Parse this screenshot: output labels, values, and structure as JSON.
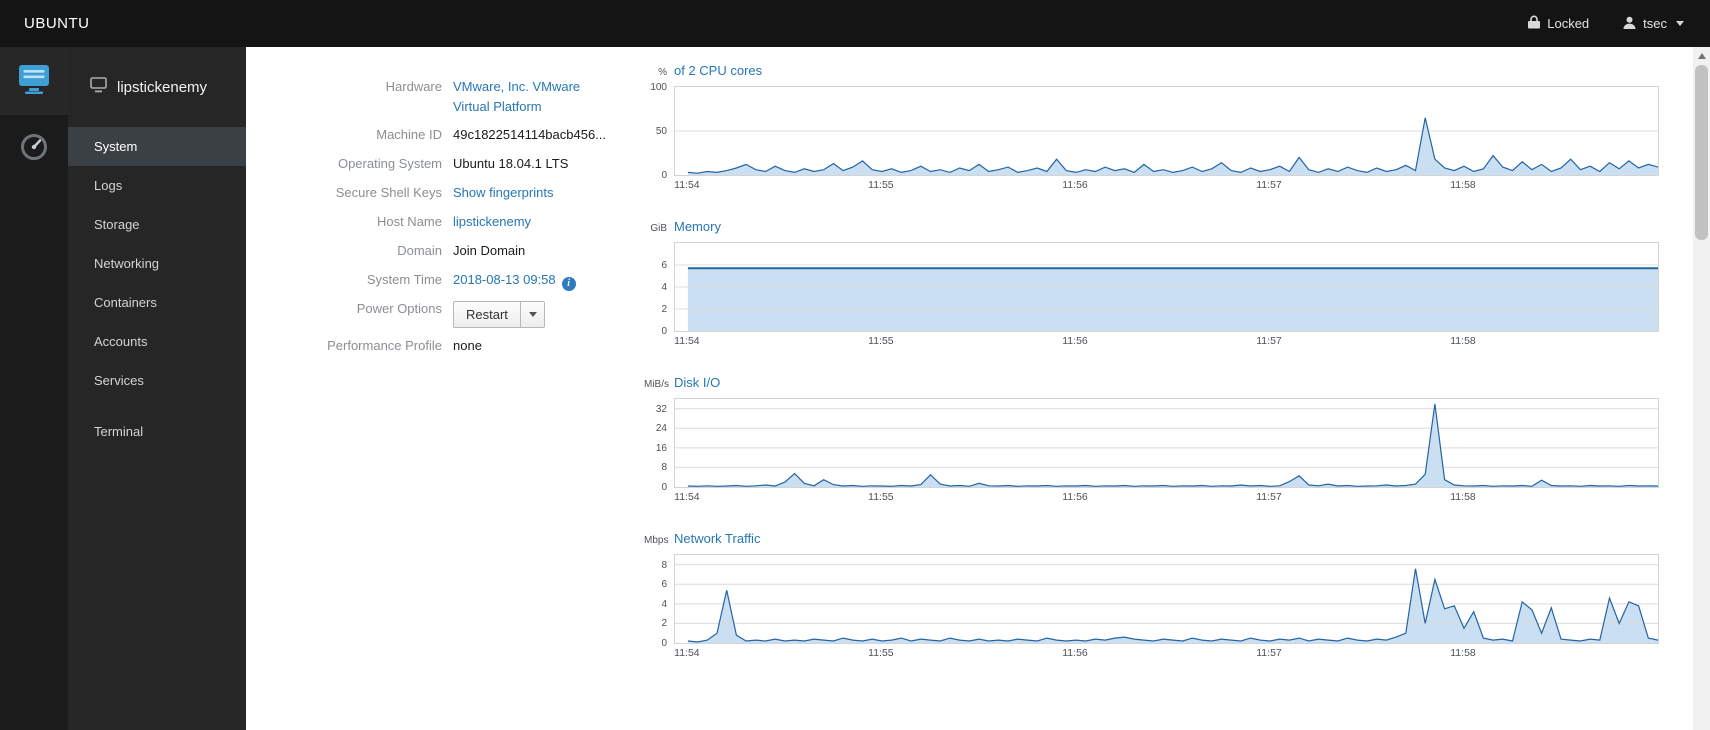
{
  "topbar": {
    "brand": "UBUNTU",
    "locked_label": "Locked",
    "user": "tsec"
  },
  "sidebar": {
    "host": "lipstickenemy",
    "items": [
      {
        "label": "System",
        "selected": true
      },
      {
        "label": "Logs",
        "selected": false
      },
      {
        "label": "Storage",
        "selected": false
      },
      {
        "label": "Networking",
        "selected": false
      },
      {
        "label": "Containers",
        "selected": false
      },
      {
        "label": "Accounts",
        "selected": false
      },
      {
        "label": "Services",
        "selected": false
      }
    ],
    "secondary_items": [
      {
        "label": "Terminal",
        "selected": false
      }
    ]
  },
  "system_info": {
    "info_glyph": "i",
    "rows": [
      {
        "label": "Hardware",
        "value": "VMware, Inc. VMware",
        "value2": "Virtual Platform",
        "kind": "link"
      },
      {
        "label": "Machine ID",
        "value": "49c1822514114bacb456...",
        "kind": "text"
      },
      {
        "label": "Operating System",
        "value": "Ubuntu 18.04.1 LTS",
        "kind": "text"
      },
      {
        "label": "Secure Shell Keys",
        "value": "Show fingerprints",
        "kind": "link"
      },
      {
        "label": "Host Name",
        "value": "lipstickenemy",
        "kind": "link"
      },
      {
        "label": "Domain",
        "value": "Join Domain",
        "kind": "text"
      },
      {
        "label": "System Time",
        "value": "2018-08-13 09:58",
        "kind": "link-info"
      },
      {
        "label": "Power Options",
        "value": "Restart",
        "kind": "split-button"
      },
      {
        "label": "Performance Profile",
        "value": "none",
        "kind": "text"
      }
    ]
  },
  "chart_colors": {
    "line": "#2264a5",
    "fill": "#bdd7ee",
    "grid": "#dcdcdc",
    "link": "#2577b5"
  },
  "chart_data": [
    {
      "type": "area",
      "unit": "%",
      "title": "of 2 CPU cores",
      "ylim": [
        0,
        100
      ],
      "yticks": [
        0,
        50,
        100
      ],
      "xtick_labels": [
        "11:54",
        "11:55",
        "11:56",
        "11:57",
        "11:58"
      ],
      "xtick_seconds": [
        0,
        60,
        120,
        180,
        240
      ],
      "xlim": [
        -4,
        300
      ],
      "stroke_width": 1.2,
      "points": [
        [
          0,
          3
        ],
        [
          3,
          2
        ],
        [
          6,
          4
        ],
        [
          9,
          3
        ],
        [
          12,
          5
        ],
        [
          15,
          8
        ],
        [
          18,
          12
        ],
        [
          21,
          6
        ],
        [
          24,
          4
        ],
        [
          27,
          10
        ],
        [
          30,
          5
        ],
        [
          33,
          3
        ],
        [
          36,
          7
        ],
        [
          39,
          4
        ],
        [
          42,
          6
        ],
        [
          45,
          13
        ],
        [
          48,
          5
        ],
        [
          51,
          9
        ],
        [
          54,
          16
        ],
        [
          57,
          6
        ],
        [
          60,
          4
        ],
        [
          63,
          7
        ],
        [
          66,
          3
        ],
        [
          69,
          5
        ],
        [
          72,
          10
        ],
        [
          75,
          4
        ],
        [
          78,
          6
        ],
        [
          81,
          3
        ],
        [
          84,
          8
        ],
        [
          87,
          5
        ],
        [
          90,
          12
        ],
        [
          93,
          4
        ],
        [
          96,
          6
        ],
        [
          99,
          9
        ],
        [
          102,
          3
        ],
        [
          105,
          5
        ],
        [
          108,
          8
        ],
        [
          111,
          4
        ],
        [
          114,
          18
        ],
        [
          117,
          5
        ],
        [
          120,
          3
        ],
        [
          123,
          6
        ],
        [
          126,
          4
        ],
        [
          129,
          9
        ],
        [
          132,
          5
        ],
        [
          135,
          7
        ],
        [
          138,
          3
        ],
        [
          141,
          12
        ],
        [
          144,
          4
        ],
        [
          147,
          6
        ],
        [
          150,
          3
        ],
        [
          153,
          5
        ],
        [
          156,
          9
        ],
        [
          159,
          4
        ],
        [
          162,
          7
        ],
        [
          165,
          14
        ],
        [
          168,
          5
        ],
        [
          171,
          3
        ],
        [
          174,
          8
        ],
        [
          177,
          4
        ],
        [
          180,
          6
        ],
        [
          183,
          10
        ],
        [
          186,
          4
        ],
        [
          189,
          20
        ],
        [
          192,
          6
        ],
        [
          195,
          3
        ],
        [
          198,
          7
        ],
        [
          201,
          4
        ],
        [
          204,
          9
        ],
        [
          207,
          5
        ],
        [
          210,
          3
        ],
        [
          213,
          8
        ],
        [
          216,
          4
        ],
        [
          219,
          6
        ],
        [
          222,
          11
        ],
        [
          225,
          5
        ],
        [
          228,
          65
        ],
        [
          231,
          18
        ],
        [
          234,
          8
        ],
        [
          237,
          5
        ],
        [
          240,
          10
        ],
        [
          243,
          4
        ],
        [
          246,
          7
        ],
        [
          249,
          22
        ],
        [
          252,
          9
        ],
        [
          255,
          5
        ],
        [
          258,
          15
        ],
        [
          261,
          6
        ],
        [
          264,
          12
        ],
        [
          267,
          4
        ],
        [
          270,
          8
        ],
        [
          273,
          18
        ],
        [
          276,
          6
        ],
        [
          279,
          10
        ],
        [
          282,
          4
        ],
        [
          285,
          14
        ],
        [
          288,
          7
        ],
        [
          291,
          16
        ],
        [
          294,
          8
        ],
        [
          297,
          12
        ],
        [
          300,
          9
        ]
      ]
    },
    {
      "type": "area",
      "unit": "GiB",
      "title": "Memory",
      "ylim": [
        0,
        8
      ],
      "yticks": [
        0,
        2,
        4,
        6
      ],
      "xtick_labels": [
        "11:54",
        "11:55",
        "11:56",
        "11:57",
        "11:58"
      ],
      "xtick_seconds": [
        0,
        60,
        120,
        180,
        240
      ],
      "xlim": [
        -4,
        300
      ],
      "stroke_width": 2,
      "points": [
        [
          0,
          5.7
        ],
        [
          60,
          5.7
        ],
        [
          120,
          5.7
        ],
        [
          180,
          5.7
        ],
        [
          240,
          5.7
        ],
        [
          300,
          5.7
        ]
      ]
    },
    {
      "type": "area",
      "unit": "MiB/s",
      "title": "Disk I/O",
      "ylim": [
        0,
        36
      ],
      "yticks": [
        0,
        8,
        16,
        24,
        32
      ],
      "xtick_labels": [
        "11:54",
        "11:55",
        "11:56",
        "11:57",
        "11:58"
      ],
      "xtick_seconds": [
        0,
        60,
        120,
        180,
        240
      ],
      "xlim": [
        -4,
        300
      ],
      "stroke_width": 1.2,
      "points": [
        [
          0,
          0.4
        ],
        [
          3,
          0.3
        ],
        [
          6,
          0.5
        ],
        [
          9,
          0.3
        ],
        [
          12,
          0.4
        ],
        [
          15,
          0.6
        ],
        [
          18,
          0.3
        ],
        [
          21,
          0.5
        ],
        [
          24,
          0.8
        ],
        [
          27,
          0.4
        ],
        [
          30,
          2
        ],
        [
          33,
          5.5
        ],
        [
          36,
          1.5
        ],
        [
          39,
          0.5
        ],
        [
          42,
          3
        ],
        [
          45,
          1
        ],
        [
          48,
          0.4
        ],
        [
          51,
          0.6
        ],
        [
          54,
          0.3
        ],
        [
          57,
          0.5
        ],
        [
          60,
          0.4
        ],
        [
          63,
          0.3
        ],
        [
          66,
          0.6
        ],
        [
          69,
          0.4
        ],
        [
          72,
          1
        ],
        [
          75,
          5
        ],
        [
          78,
          1.2
        ],
        [
          81,
          0.4
        ],
        [
          84,
          0.6
        ],
        [
          87,
          0.3
        ],
        [
          90,
          1.5
        ],
        [
          93,
          0.5
        ],
        [
          96,
          0.4
        ],
        [
          99,
          0.6
        ],
        [
          102,
          0.3
        ],
        [
          105,
          0.5
        ],
        [
          108,
          0.4
        ],
        [
          111,
          0.6
        ],
        [
          114,
          0.3
        ],
        [
          117,
          0.5
        ],
        [
          120,
          0.4
        ],
        [
          123,
          0.6
        ],
        [
          126,
          0.3
        ],
        [
          129,
          0.5
        ],
        [
          132,
          0.4
        ],
        [
          135,
          0.6
        ],
        [
          138,
          0.3
        ],
        [
          141,
          0.5
        ],
        [
          144,
          0.4
        ],
        [
          147,
          0.6
        ],
        [
          150,
          0.3
        ],
        [
          153,
          0.5
        ],
        [
          156,
          0.4
        ],
        [
          159,
          0.6
        ],
        [
          162,
          0.3
        ],
        [
          165,
          0.5
        ],
        [
          168,
          0.4
        ],
        [
          171,
          0.8
        ],
        [
          174,
          0.4
        ],
        [
          177,
          0.6
        ],
        [
          180,
          0.3
        ],
        [
          183,
          0.5
        ],
        [
          186,
          2.2
        ],
        [
          189,
          4.6
        ],
        [
          192,
          0.8
        ],
        [
          195,
          0.5
        ],
        [
          198,
          1.2
        ],
        [
          201,
          0.4
        ],
        [
          204,
          0.6
        ],
        [
          207,
          0.3
        ],
        [
          210,
          0.4
        ],
        [
          213,
          0.5
        ],
        [
          216,
          0.8
        ],
        [
          219,
          0.4
        ],
        [
          222,
          0.6
        ],
        [
          225,
          1.2
        ],
        [
          228,
          5.2
        ],
        [
          231,
          34
        ],
        [
          234,
          3
        ],
        [
          237,
          0.8
        ],
        [
          240,
          0.5
        ],
        [
          243,
          0.4
        ],
        [
          246,
          0.6
        ],
        [
          249,
          0.3
        ],
        [
          252,
          0.5
        ],
        [
          255,
          0.4
        ],
        [
          258,
          0.6
        ],
        [
          261,
          0.3
        ],
        [
          264,
          2.8
        ],
        [
          267,
          0.6
        ],
        [
          270,
          0.4
        ],
        [
          273,
          0.5
        ],
        [
          276,
          0.3
        ],
        [
          279,
          0.6
        ],
        [
          282,
          0.4
        ],
        [
          285,
          0.5
        ],
        [
          288,
          0.3
        ],
        [
          291,
          0.6
        ],
        [
          294,
          0.4
        ],
        [
          297,
          0.5
        ],
        [
          300,
          0.4
        ]
      ]
    },
    {
      "type": "area",
      "unit": "Mbps",
      "title": "Network Traffic",
      "ylim": [
        0,
        9
      ],
      "yticks": [
        0,
        2,
        4,
        6,
        8
      ],
      "xtick_labels": [
        "11:54",
        "11:55",
        "11:56",
        "11:57",
        "11:58"
      ],
      "xtick_seconds": [
        0,
        60,
        120,
        180,
        240
      ],
      "xlim": [
        -4,
        300
      ],
      "stroke_width": 1.2,
      "points": [
        [
          0,
          0.2
        ],
        [
          3,
          0.1
        ],
        [
          6,
          0.3
        ],
        [
          9,
          1
        ],
        [
          12,
          5.4
        ],
        [
          15,
          0.8
        ],
        [
          18,
          0.2
        ],
        [
          21,
          0.3
        ],
        [
          24,
          0.2
        ],
        [
          27,
          0.4
        ],
        [
          30,
          0.2
        ],
        [
          33,
          0.3
        ],
        [
          36,
          0.2
        ],
        [
          39,
          0.4
        ],
        [
          42,
          0.3
        ],
        [
          45,
          0.2
        ],
        [
          48,
          0.5
        ],
        [
          51,
          0.3
        ],
        [
          54,
          0.2
        ],
        [
          57,
          0.4
        ],
        [
          60,
          0.2
        ],
        [
          63,
          0.3
        ],
        [
          66,
          0.5
        ],
        [
          69,
          0.2
        ],
        [
          72,
          0.4
        ],
        [
          75,
          0.3
        ],
        [
          78,
          0.2
        ],
        [
          81,
          0.5
        ],
        [
          84,
          0.3
        ],
        [
          87,
          0.2
        ],
        [
          90,
          0.4
        ],
        [
          93,
          0.2
        ],
        [
          96,
          0.3
        ],
        [
          99,
          0.2
        ],
        [
          102,
          0.4
        ],
        [
          105,
          0.3
        ],
        [
          108,
          0.2
        ],
        [
          111,
          0.5
        ],
        [
          114,
          0.3
        ],
        [
          117,
          0.2
        ],
        [
          120,
          0.3
        ],
        [
          123,
          0.2
        ],
        [
          126,
          0.4
        ],
        [
          129,
          0.3
        ],
        [
          132,
          0.5
        ],
        [
          135,
          0.6
        ],
        [
          138,
          0.4
        ],
        [
          141,
          0.3
        ],
        [
          144,
          0.2
        ],
        [
          147,
          0.4
        ],
        [
          150,
          0.3
        ],
        [
          153,
          0.2
        ],
        [
          156,
          0.5
        ],
        [
          159,
          0.3
        ],
        [
          162,
          0.2
        ],
        [
          165,
          0.4
        ],
        [
          168,
          0.3
        ],
        [
          171,
          0.2
        ],
        [
          174,
          0.5
        ],
        [
          177,
          0.3
        ],
        [
          180,
          0.2
        ],
        [
          183,
          0.4
        ],
        [
          186,
          0.3
        ],
        [
          189,
          0.5
        ],
        [
          192,
          0.2
        ],
        [
          195,
          0.4
        ],
        [
          198,
          0.3
        ],
        [
          201,
          0.2
        ],
        [
          204,
          0.5
        ],
        [
          207,
          0.3
        ],
        [
          210,
          0.2
        ],
        [
          213,
          0.4
        ],
        [
          216,
          0.3
        ],
        [
          219,
          0.6
        ],
        [
          222,
          1
        ],
        [
          225,
          7.6
        ],
        [
          228,
          2
        ],
        [
          231,
          6.5
        ],
        [
          234,
          3.5
        ],
        [
          237,
          3.8
        ],
        [
          240,
          1.5
        ],
        [
          243,
          3.2
        ],
        [
          246,
          0.5
        ],
        [
          249,
          0.3
        ],
        [
          252,
          0.4
        ],
        [
          255,
          0.2
        ],
        [
          258,
          4.2
        ],
        [
          261,
          3.4
        ],
        [
          264,
          1
        ],
        [
          267,
          3.6
        ],
        [
          270,
          0.4
        ],
        [
          273,
          0.3
        ],
        [
          276,
          0.2
        ],
        [
          279,
          0.4
        ],
        [
          282,
          0.3
        ],
        [
          285,
          4.6
        ],
        [
          288,
          2
        ],
        [
          291,
          4.2
        ],
        [
          294,
          3.8
        ],
        [
          297,
          0.5
        ],
        [
          300,
          0.3
        ]
      ]
    }
  ]
}
